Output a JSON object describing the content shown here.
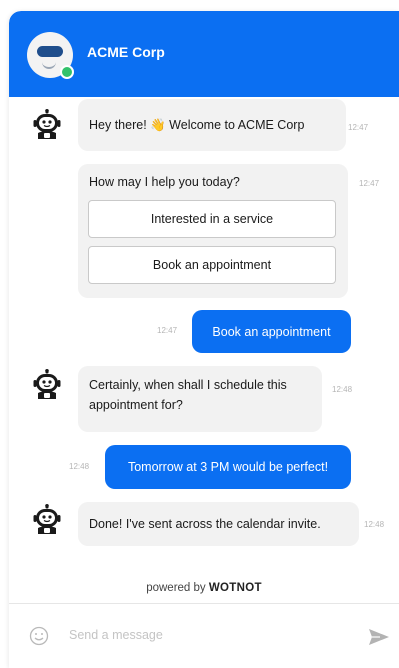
{
  "header": {
    "title": "ACME Corp"
  },
  "messages": {
    "m1": {
      "text": "Hey there! 👋 Welcome to ACME Corp",
      "time": "12:47"
    },
    "m2": {
      "text": "How may I help you today?",
      "time": "12:47",
      "options": [
        "Interested in a service",
        "Book an appointment"
      ]
    },
    "u1": {
      "text": "Book an appointment",
      "time": "12:47"
    },
    "m3": {
      "text": "Certainly, when shall I schedule this appointment for?",
      "time": "12:48"
    },
    "u2": {
      "text": "Tomorrow at 3 PM would be perfect!",
      "time": "12:48"
    },
    "m4": {
      "text": "Done! I've sent across the calendar invite.",
      "time": "12:48"
    }
  },
  "footer": {
    "powered_prefix": "powered by",
    "powered_brand": "WOTNOT"
  },
  "composer": {
    "placeholder": "Send a message"
  },
  "colors": {
    "accent": "#0b6ff2",
    "bot_bubble": "#f2f2f2",
    "status": "#32c26a"
  }
}
